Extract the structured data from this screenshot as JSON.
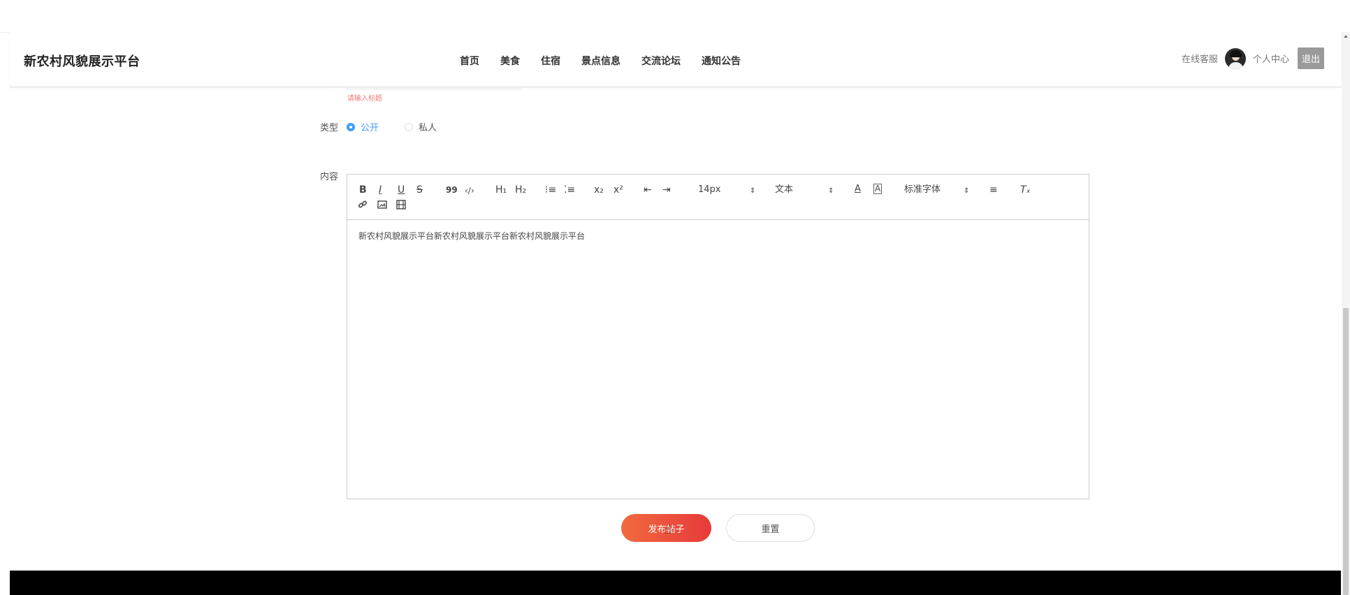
{
  "brand": "新农村风貌展示平台",
  "menu": [
    "首页",
    "美食",
    "住宿",
    "景点信息",
    "交流论坛",
    "通知公告"
  ],
  "user": {
    "service": "在线客服",
    "center": "个人中心",
    "logout": "退出"
  },
  "form": {
    "title_hint": "请输入标题",
    "type_label": "类型",
    "type_options": [
      "公开",
      "私人"
    ],
    "type_selected": "公开",
    "content_label": "内容",
    "content_text": "新农村风貌展示平台新农村风貌展示平台新农村风貌展示平台"
  },
  "toolbar": {
    "bold": "B",
    "italic": "I",
    "underline": "U",
    "strike": "S",
    "blockquote": "99",
    "code": "‹/›",
    "h1": "H₁",
    "h2": "H₂",
    "ordered_list": "⁝≡",
    "bullet_list": "⁚≡",
    "subscript": "x₂",
    "superscript": "x²",
    "outdent": "⇤",
    "indent": "⇥",
    "size": "14px",
    "header": "文本",
    "color": "A",
    "background": "A",
    "font": "标准字体",
    "align": "≡",
    "clean": "Tₓ",
    "select_arrow": "⇕"
  },
  "buttons": {
    "publish": "发布帖子",
    "reset": "重置"
  },
  "colors": {
    "accent": "#409eff",
    "publish_start": "#f26a3f",
    "publish_end": "#e63a3a"
  }
}
